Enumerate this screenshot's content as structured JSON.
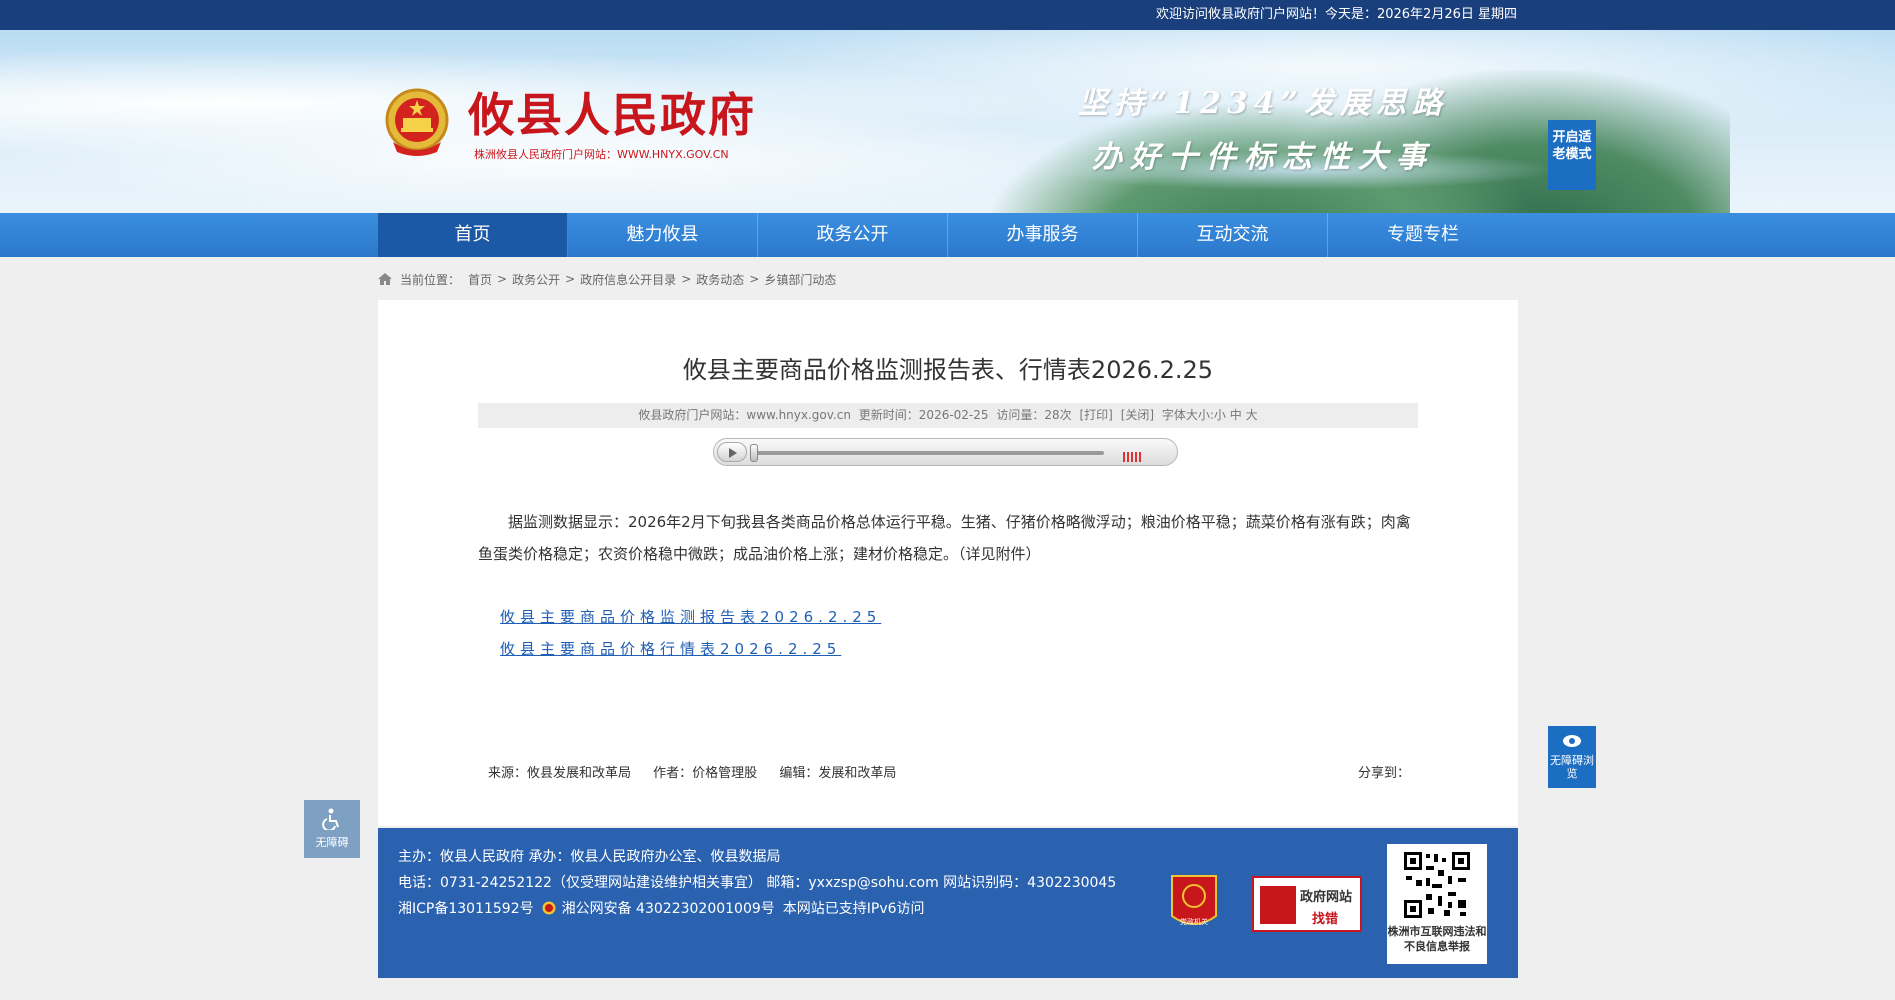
{
  "topbar": {
    "welcome": "欢迎访问攸县政府门户网站！今天是：2026年2月26日 星期四"
  },
  "header": {
    "site_name": "攸县人民政府",
    "site_url": "株洲攸县人民政府门户网站：WWW.HNYX.GOV.CN",
    "slogan_line1": "坚持“1234”发展思路",
    "slogan_line2": "办好十件标志性大事",
    "elder_mode": "开启适老模式"
  },
  "nav": {
    "items": [
      {
        "label": "首页"
      },
      {
        "label": "魅力攸县"
      },
      {
        "label": "政务公开"
      },
      {
        "label": "办事服务"
      },
      {
        "label": "互动交流"
      },
      {
        "label": "专题专栏"
      }
    ]
  },
  "breadcrumb": {
    "prefix": "当前位置：",
    "items": [
      "首页",
      "政务公开",
      "政府信息公开目录",
      "政务动态",
      "乡镇部门动态"
    ],
    "separator": ">"
  },
  "article": {
    "title": "攸县主要商品价格监测报告表、行情表2026.2.25",
    "meta": {
      "site": "攸县政府门户网站：www.hnyx.gov.cn",
      "updated": "更新时间：2026-02-25",
      "views": "访问量：28次",
      "print": "[打印]",
      "close": "[关闭]",
      "font_size": "字体大小:小 中 大"
    },
    "body": "据监测数据显示：2026年2月下旬我县各类商品价格总体运行平稳。生猪、仔猪价格略微浮动；粮油价格平稳；蔬菜价格有涨有跌；肉禽鱼蛋类价格稳定；农资价格稳中微跌；成品油价格上涨；建材价格稳定。（详见附件）",
    "attachments": [
      "攸县主要商品价格监测报告表2026.2.25",
      "攸县主要商品价格行情表2026.2.25"
    ],
    "source": "来源：攸县发展和改革局",
    "author": "作者：价格管理股",
    "editor": "编辑：发展和改革局",
    "share": "分享到："
  },
  "footer": {
    "line1": "主办：攸县人民政府 承办：攸县人民政府办公室、攸县数据局",
    "line2": "电话：0731-24252122（仅受理网站建设维护相关事宜） 邮箱：yxxzsp@sohu.com 网站识别码：4302230045",
    "icp": "湘ICP备13011592号",
    "police": "湘公网安备 43022302001009号",
    "ipv6": "本网站已支持IPv6访问",
    "badge": "党政机关",
    "zhaocuo_title": "政府网站",
    "zhaocuo_sub": "找错",
    "qr_caption": "株洲市互联网违法和不良信息举报"
  },
  "accessibility": {
    "left_label": "无障碍",
    "right_label": "无障碍浏览"
  },
  "colors": {
    "brand_red": "#c8161d",
    "nav_blue": "#2a78cc",
    "nav_active": "#1b58a6",
    "footer_blue": "#2a62b0",
    "link_blue": "#1f5fb5"
  }
}
